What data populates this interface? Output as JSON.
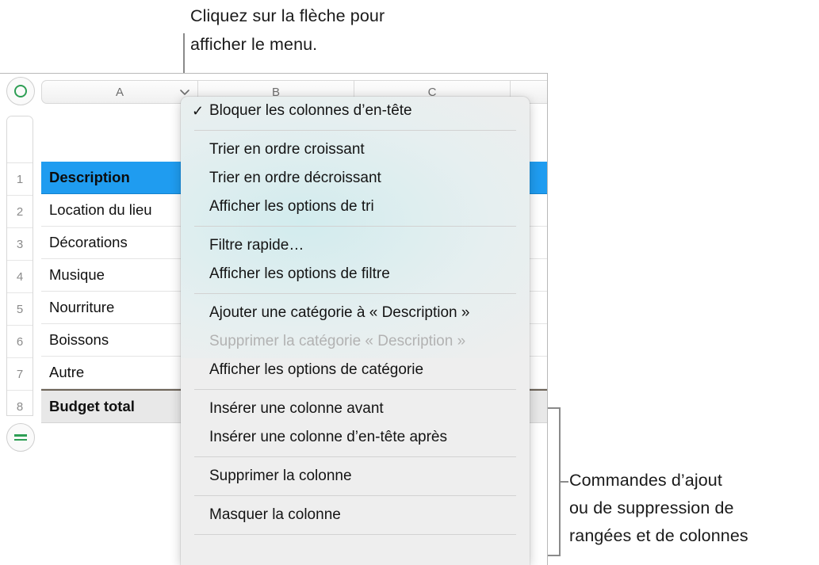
{
  "callouts": {
    "top": "Cliquez sur la flèche pour\nafficher le menu.",
    "right": "Commandes d’ajout\nou de suppression de\nrangées et de colonnes"
  },
  "spreadsheet": {
    "corner_button_icon": "green-circle-icon",
    "add_rows_button_icon": "green-rows-icon",
    "column_headers": [
      "A",
      "B",
      "C",
      ""
    ],
    "active_column_menu_icon": "chevron-down-icon",
    "row_numbers": [
      "1",
      "2",
      "3",
      "4",
      "5",
      "6",
      "7",
      "8"
    ],
    "rows": [
      {
        "number": "1",
        "value": "Description",
        "style": "header-selected"
      },
      {
        "number": "2",
        "value": "Location du lieu",
        "style": "normal"
      },
      {
        "number": "3",
        "value": "Décorations",
        "style": "normal"
      },
      {
        "number": "4",
        "value": "Musique",
        "style": "normal"
      },
      {
        "number": "5",
        "value": "Nourriture",
        "style": "normal"
      },
      {
        "number": "6",
        "value": "Boissons",
        "style": "normal"
      },
      {
        "number": "7",
        "value": "Autre",
        "style": "normal"
      },
      {
        "number": "8",
        "value": "Budget total",
        "style": "total"
      }
    ],
    "colors": {
      "header_selected_bg": "#1f9cf0",
      "total_row_bg": "#e8e8e8",
      "accent_green": "#2e9e54"
    }
  },
  "menu": {
    "sections": [
      {
        "items": [
          {
            "label": "Bloquer les colonnes d’en-tête",
            "checked": true,
            "disabled": false
          }
        ]
      },
      {
        "items": [
          {
            "label": "Trier en ordre croissant",
            "checked": false,
            "disabled": false
          },
          {
            "label": "Trier en ordre décroissant",
            "checked": false,
            "disabled": false
          },
          {
            "label": "Afficher les options de tri",
            "checked": false,
            "disabled": false
          }
        ]
      },
      {
        "items": [
          {
            "label": "Filtre rapide…",
            "checked": false,
            "disabled": false
          },
          {
            "label": "Afficher les options de filtre",
            "checked": false,
            "disabled": false
          }
        ]
      },
      {
        "items": [
          {
            "label": "Ajouter une catégorie à « Description »",
            "checked": false,
            "disabled": false
          },
          {
            "label": "Supprimer la catégorie « Description »",
            "checked": false,
            "disabled": true
          },
          {
            "label": "Afficher les options de catégorie",
            "checked": false,
            "disabled": false
          }
        ]
      },
      {
        "items": [
          {
            "label": "Insérer une colonne avant",
            "checked": false,
            "disabled": false
          },
          {
            "label": "Insérer une colonne d’en-tête après",
            "checked": false,
            "disabled": false
          }
        ]
      },
      {
        "items": [
          {
            "label": "Supprimer la colonne",
            "checked": false,
            "disabled": false
          }
        ]
      },
      {
        "items": [
          {
            "label": "Masquer la colonne",
            "checked": false,
            "disabled": false
          }
        ]
      }
    ],
    "check_glyph": "✓"
  }
}
